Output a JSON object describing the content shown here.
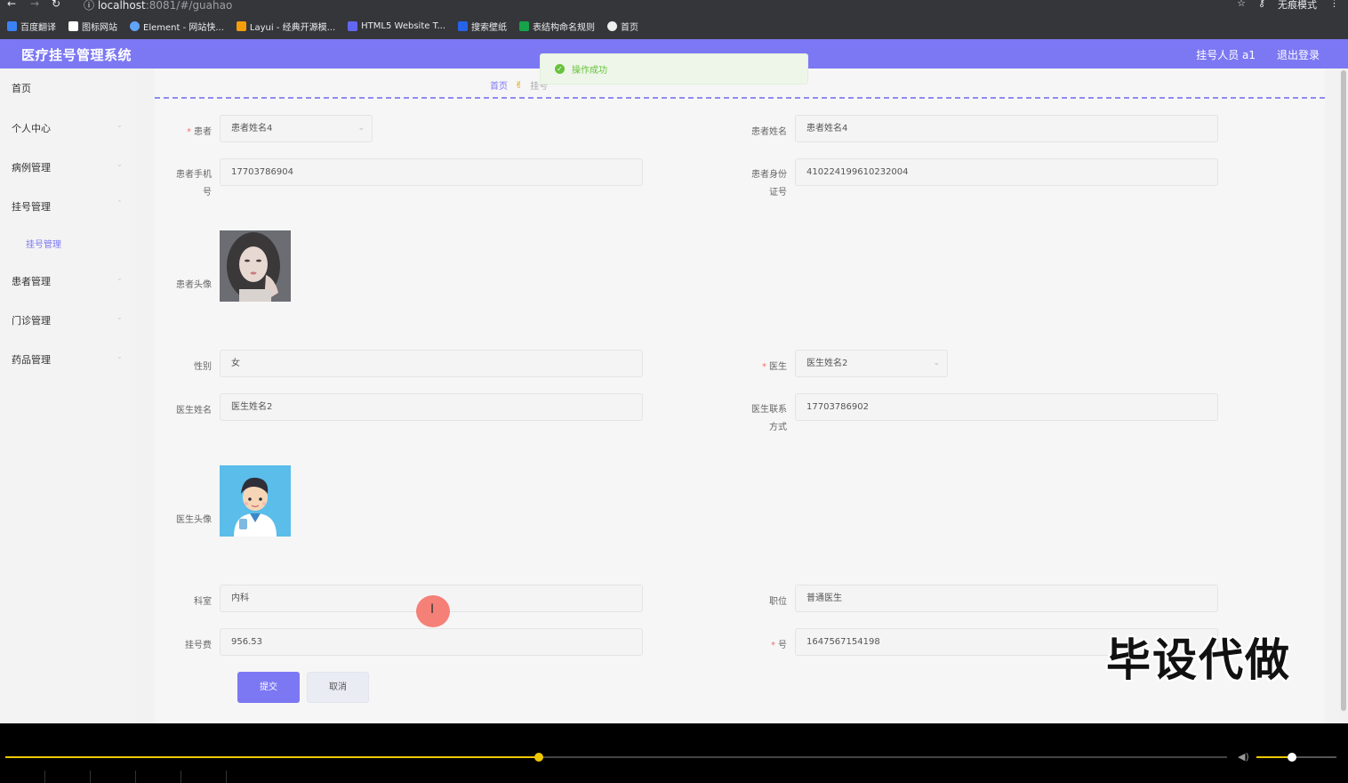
{
  "browser": {
    "url_host": "localhost",
    "url_path": ":8081/#/guahao",
    "incognito_label": "无痕模式",
    "bookmarks": [
      "百度翻译",
      "图标网站",
      "Element - 网站快...",
      "Layui - 经典开源模...",
      "HTML5 Website T...",
      "搜索壁纸",
      "表结构命名规则",
      "首页"
    ]
  },
  "header": {
    "title": "医疗挂号管理系统",
    "user": "挂号人员 a1",
    "logout": "退出登录"
  },
  "sidebar": {
    "items": [
      "首页",
      "个人中心",
      "病例管理",
      "挂号管理",
      "患者管理",
      "门诊管理",
      "药品管理"
    ],
    "sub_item": "挂号管理"
  },
  "breadcrumb": {
    "home": "首页",
    "current": "挂号"
  },
  "toast": {
    "message": "操作成功"
  },
  "form": {
    "patient": {
      "label": "患者",
      "value": "患者姓名4"
    },
    "patient_name": {
      "label": "患者姓名",
      "value": "患者姓名4"
    },
    "patient_phone": {
      "label_1": "患者手机",
      "label_2": "号",
      "value": "17703786904"
    },
    "patient_id": {
      "label_1": "患者身份",
      "label_2": "证号",
      "value": "410224199610232004"
    },
    "patient_avatar": {
      "label": "患者头像"
    },
    "gender": {
      "label": "性别",
      "value": "女"
    },
    "doctor": {
      "label": "医生",
      "value": "医生姓名2"
    },
    "doctor_name": {
      "label": "医生姓名",
      "value": "医生姓名2"
    },
    "doctor_contact": {
      "label_1": "医生联系",
      "label_2": "方式",
      "value": "17703786902"
    },
    "doctor_avatar": {
      "label": "医生头像"
    },
    "department": {
      "label": "科室",
      "value": "内科"
    },
    "position": {
      "label": "职位",
      "value": "普通医生"
    },
    "fee": {
      "label": "挂号费",
      "value": "956.53"
    },
    "number": {
      "label": "号",
      "value": "1647567154198"
    },
    "submit": "提交",
    "cancel": "取消"
  },
  "watermark": "毕设代做",
  "player": {
    "progress": 0.437,
    "volume": 0.44
  },
  "colors": {
    "accent": "#7c78f3",
    "success": "#67c23a",
    "required": "#f56c6c",
    "player": "#f0c800"
  }
}
